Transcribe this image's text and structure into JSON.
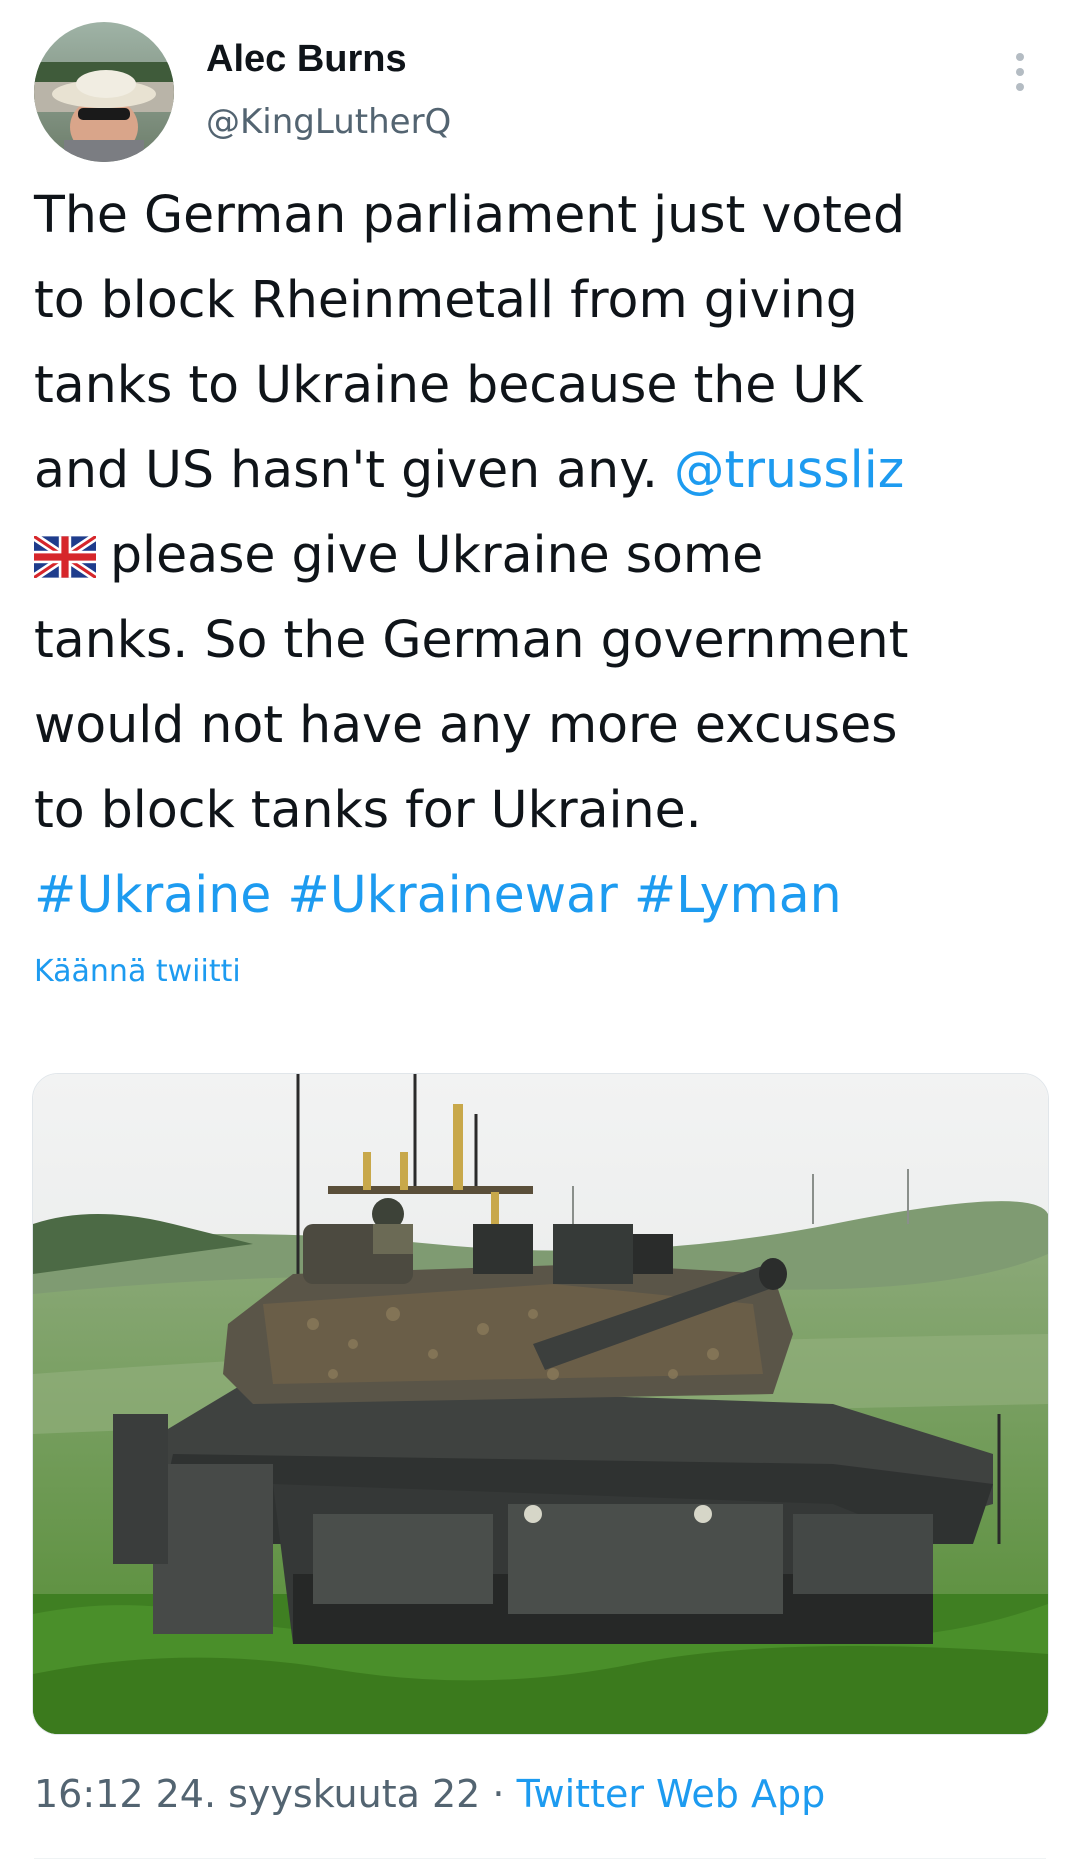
{
  "author": {
    "display_name": "Alec Burns",
    "handle": "@KingLutherQ"
  },
  "tweet": {
    "line1": "The German parliament just voted",
    "line2": "to block Rheinmetall from giving",
    "line3": "tanks to Ukraine because the UK",
    "line4_text": "and US hasn't given any. ",
    "mention": "@trussliz",
    "flag_icon": "uk-flag-emoji",
    "line5": "please give Ukraine some",
    "line6": "tanks. So the German government",
    "line7": "would not have any more excuses",
    "line8": "to block tanks for Ukraine.",
    "hashtags": [
      "#Ukraine",
      "#Ukrainewar",
      "#Lyman"
    ]
  },
  "translate_label": "Käännä twiitti",
  "media": {
    "icon": "tank-photo"
  },
  "meta": {
    "time": "16:12",
    "date": "24. syyskuuta 22",
    "separator": "·",
    "source": "Twitter Web App"
  },
  "colors": {
    "link": "#1d9bf0",
    "text": "#0f1419",
    "secondary": "#536471"
  }
}
